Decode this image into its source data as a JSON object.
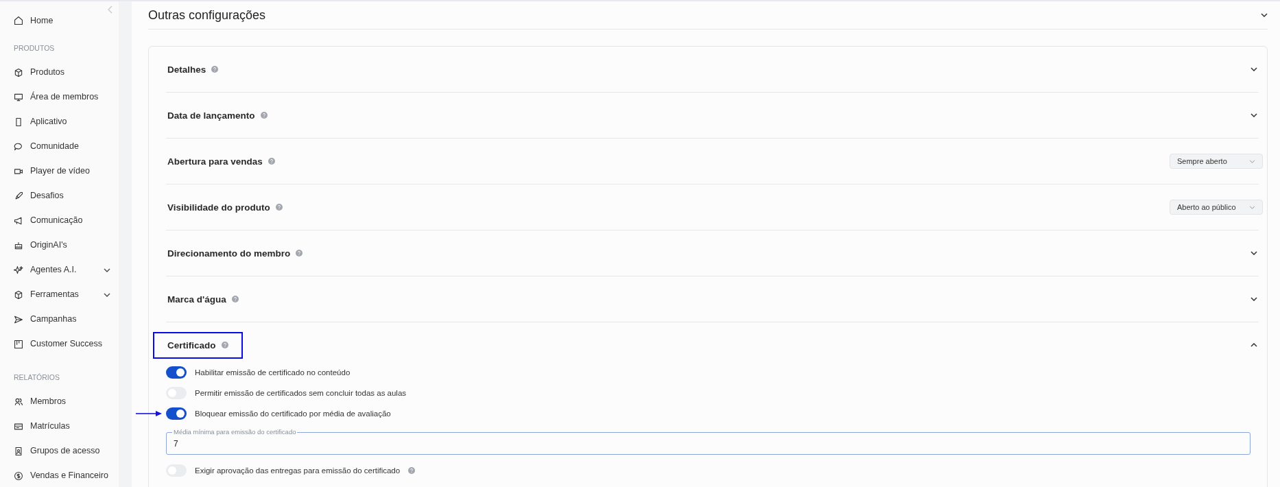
{
  "sidebar": {
    "home": {
      "label": "Home",
      "selected": false
    },
    "groups": [
      {
        "heading": "PRODUTOS",
        "items": [
          {
            "label": "Produtos",
            "expandable": false
          },
          {
            "label": "Área de membros",
            "expandable": false
          },
          {
            "label": "Aplicativo",
            "expandable": false
          },
          {
            "label": "Comunidade",
            "expandable": false
          },
          {
            "label": "Player de vídeo",
            "expandable": false
          },
          {
            "label": "Desafios",
            "expandable": false
          },
          {
            "label": "Comunicação",
            "expandable": false
          },
          {
            "label": "OriginAI's",
            "expandable": false
          },
          {
            "label": "Agentes A.I.",
            "expandable": true
          },
          {
            "label": "Ferramentas",
            "expandable": true
          },
          {
            "label": "Campanhas",
            "expandable": false
          },
          {
            "label": "Customer Success",
            "expandable": false
          }
        ]
      },
      {
        "heading": "RELATÓRIOS",
        "items": [
          {
            "label": "Membros",
            "expandable": false
          },
          {
            "label": "Matrículas",
            "expandable": false
          },
          {
            "label": "Grupos de acesso",
            "expandable": false
          },
          {
            "label": "Vendas e Financeiro",
            "expandable": false
          }
        ]
      }
    ]
  },
  "panel": {
    "title": "Outras configurações",
    "expanded": true,
    "sections": [
      {
        "kind": "collapsible",
        "title": "Detalhes",
        "expanded": false,
        "highlighted": false
      },
      {
        "kind": "collapsible",
        "title": "Data de lançamento",
        "expanded": false,
        "highlighted": false
      },
      {
        "kind": "select",
        "title": "Abertura para vendas",
        "value": "Sempre aberto",
        "highlighted": false
      },
      {
        "kind": "select",
        "title": "Visibilidade do produto",
        "value": "Aberto ao público",
        "highlighted": false
      },
      {
        "kind": "collapsible",
        "title": "Direcionamento do membro",
        "expanded": false,
        "highlighted": false
      },
      {
        "kind": "collapsible",
        "title": "Marca d'água",
        "expanded": false,
        "highlighted": false
      },
      {
        "kind": "collapsible",
        "title": "Certificado",
        "expanded": true,
        "highlighted": true,
        "options": [
          {
            "kind": "toggle",
            "label": "Habilitar emissão de certificado no conteúdo",
            "on": true,
            "help": false,
            "arrow": false
          },
          {
            "kind": "toggle",
            "label": "Permitir emissão de certificados sem concluir todas as aulas",
            "on": false,
            "help": false,
            "arrow": false
          },
          {
            "kind": "toggle",
            "label": "Bloquear emissão do certificado por média de avaliação",
            "on": true,
            "help": false,
            "arrow": true
          },
          {
            "kind": "field",
            "label": "Média mínima para emissão do certificado",
            "value": "7"
          },
          {
            "kind": "toggle",
            "label": "Exigir aprovação das entregas para emissão do certificado",
            "on": false,
            "help": true,
            "arrow": false
          }
        ]
      }
    ]
  }
}
